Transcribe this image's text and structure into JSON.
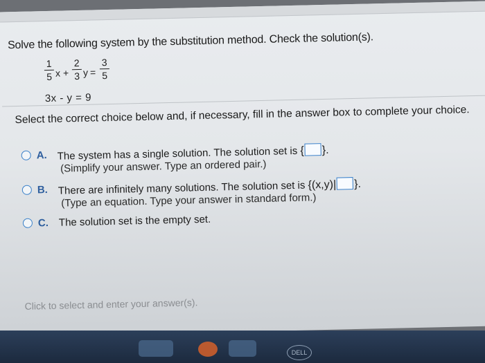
{
  "question": {
    "prompt": "Solve the following system by the substitution method. Check the solution(s)."
  },
  "equations": {
    "eq1": {
      "a_num": "1",
      "a_den": "5",
      "x_var": "x",
      "plus": "+",
      "b_num": "2",
      "b_den": "3",
      "y_var": "y",
      "equals": "=",
      "c_num": "3",
      "c_den": "5"
    },
    "eq2": "3x  -  y = 9"
  },
  "instruction": "Select the correct choice below and, if necessary, fill in the answer box to complete your choice.",
  "choices": [
    {
      "letter": "A.",
      "text": "The system has a single solution. The solution set is",
      "set_open": "{",
      "set_close": "}.",
      "hint": "(Simplify your answer. Type an ordered pair.)"
    },
    {
      "letter": "B.",
      "text": "There are infinitely many solutions. The solution set is",
      "set_open": "{(x,y)|",
      "set_close": "}.",
      "hint": "(Type an equation. Type your answer in standard form.)"
    },
    {
      "letter": "C.",
      "text": "The solution set is the empty set."
    }
  ],
  "footer": "Click to select and enter your answer(s).",
  "taskbar": {
    "brand_badge": "DELL"
  },
  "colors": {
    "accent": "#3a80c9",
    "choice_letter": "#2f5f9e",
    "taskbar": "#1c2a3e"
  }
}
